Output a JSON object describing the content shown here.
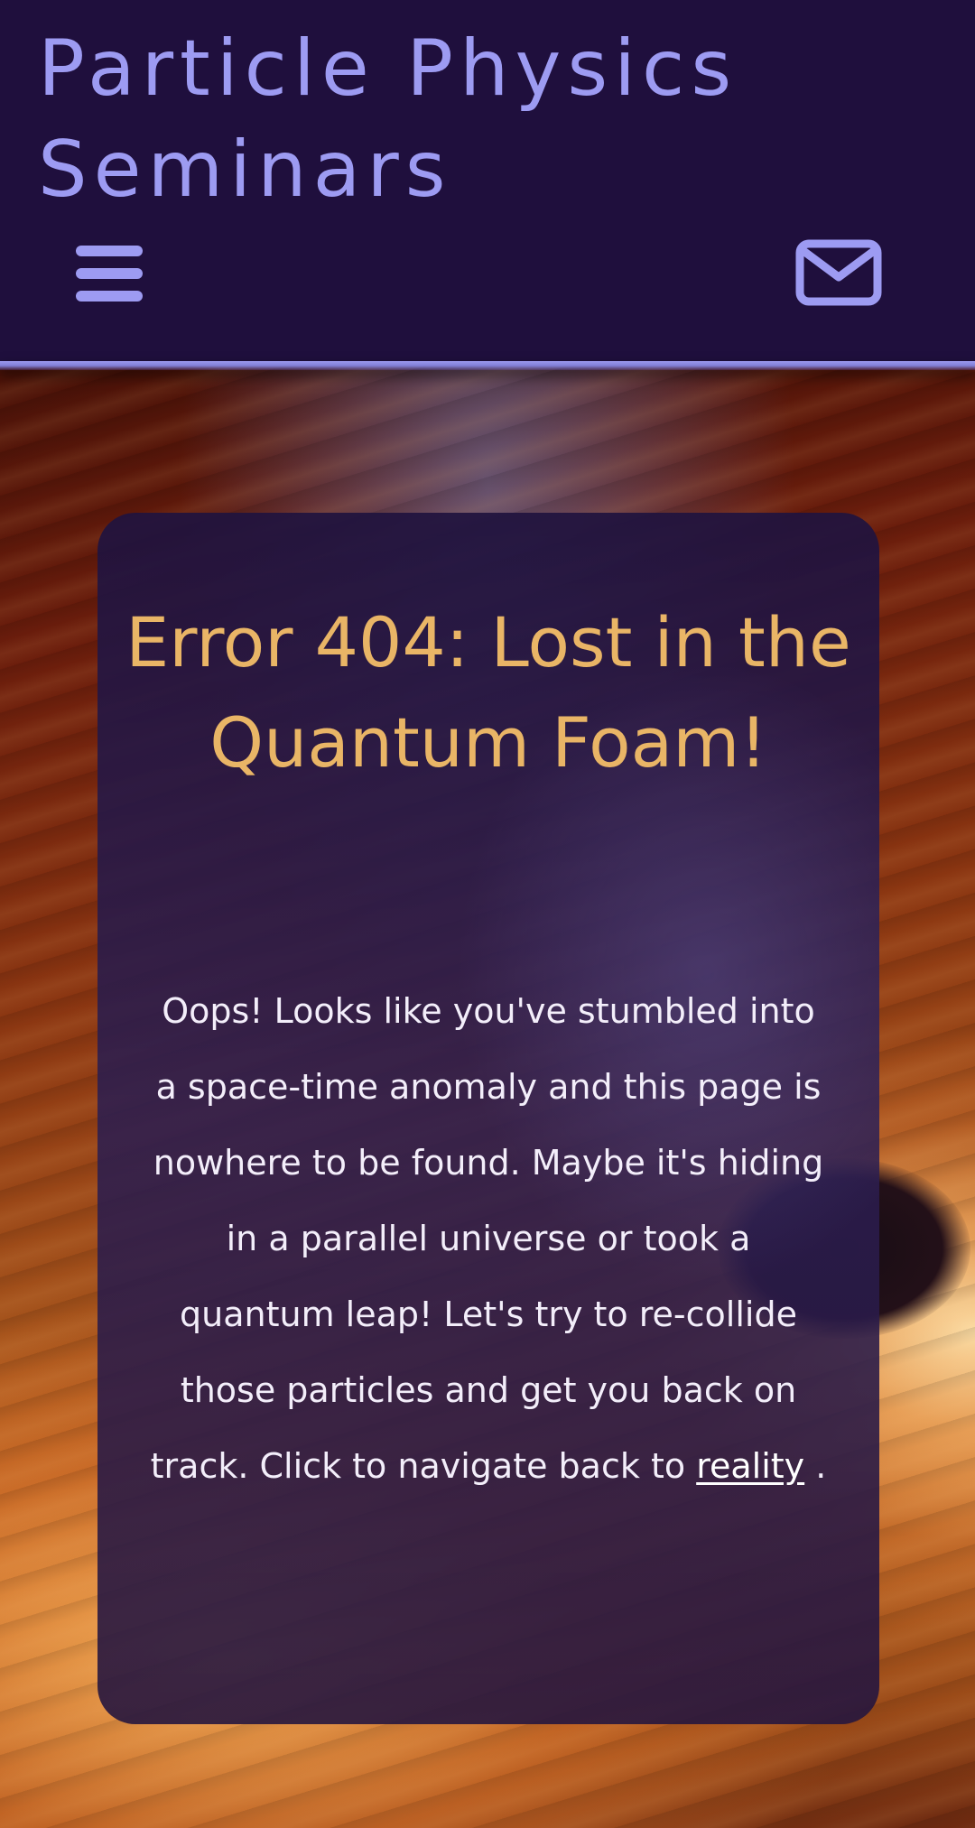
{
  "header": {
    "title": "Particle Physics Seminars",
    "menu_icon": "hamburger-menu-icon",
    "mail_icon": "envelope-icon"
  },
  "error": {
    "title": "Error 404: Lost in the Quantum Foam!",
    "message": "Oops! Looks like you've stumbled into a space-time anomaly and this page is nowhere to be found. Maybe it's hiding in a parallel universe or took a quantum leap! Let's try to re-collide those particles and get you back on track. Click to navigate back to",
    "link_label": "reality",
    "message_end": " ."
  },
  "colors": {
    "header_background": "#1f0f3d",
    "header_text": "#9d9bf2",
    "title_accent": "#e9b566",
    "card_text": "#f3eefa"
  }
}
